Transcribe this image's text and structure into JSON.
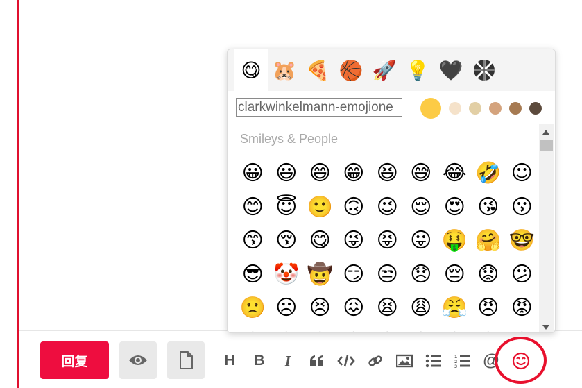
{
  "picker": {
    "categories": [
      {
        "name": "smileys",
        "glyph": "😋",
        "active": true
      },
      {
        "name": "animals",
        "glyph": "🐹"
      },
      {
        "name": "food",
        "glyph": "🍕"
      },
      {
        "name": "activity",
        "glyph": "🏀"
      },
      {
        "name": "travel",
        "glyph": "🚀"
      },
      {
        "name": "objects",
        "glyph": "💡"
      },
      {
        "name": "symbols",
        "glyph": "🖤"
      },
      {
        "name": "flags",
        "glyph": "🇬🇧"
      }
    ],
    "search_value": "clarkwinkelmann-emojione",
    "skin_tones": [
      "#fccb45",
      "#f5e2ca",
      "#e2cfa5",
      "#d4a37d",
      "#a67a52",
      "#5c4a3c"
    ],
    "section_title": "Smileys & People",
    "emoji_rows": [
      [
        "😀",
        "😃",
        "😄",
        "😁",
        "😆",
        "😅",
        "😂",
        "🤣",
        "☺"
      ],
      [
        "😊",
        "😇",
        "🙂",
        "🙃",
        "😉",
        "😌",
        "😍",
        "😘",
        "😗"
      ],
      [
        "😙",
        "😚",
        "😋",
        "😜",
        "😝",
        "😛",
        "🤑",
        "🤗",
        "🤓"
      ],
      [
        "😎",
        "🤡",
        "🤠",
        "😏",
        "😒",
        "😞",
        "😔",
        "😟",
        "😕"
      ],
      [
        "🙁",
        "☹",
        "😣",
        "😖",
        "😫",
        "😩",
        "😤",
        "😠",
        "😡"
      ],
      [
        "😶",
        "😐",
        "😑",
        "😯",
        "😦",
        "😧",
        "😮",
        "😲",
        "😵"
      ]
    ]
  },
  "toolbar": {
    "reply_label": "回复",
    "preview_icon": "eye-icon",
    "draft_icon": "file-icon",
    "tools": [
      "H",
      "B",
      "I",
      "quote-icon",
      "code-icon",
      "link-icon",
      "image-icon",
      "bullet-list-icon",
      "ordered-list-icon",
      "mention-icon",
      "emoji-icon"
    ]
  },
  "colors": {
    "accent": "#e0102f",
    "reply_button": "#ee0d3f",
    "highlight_ring": "#e8102d"
  }
}
